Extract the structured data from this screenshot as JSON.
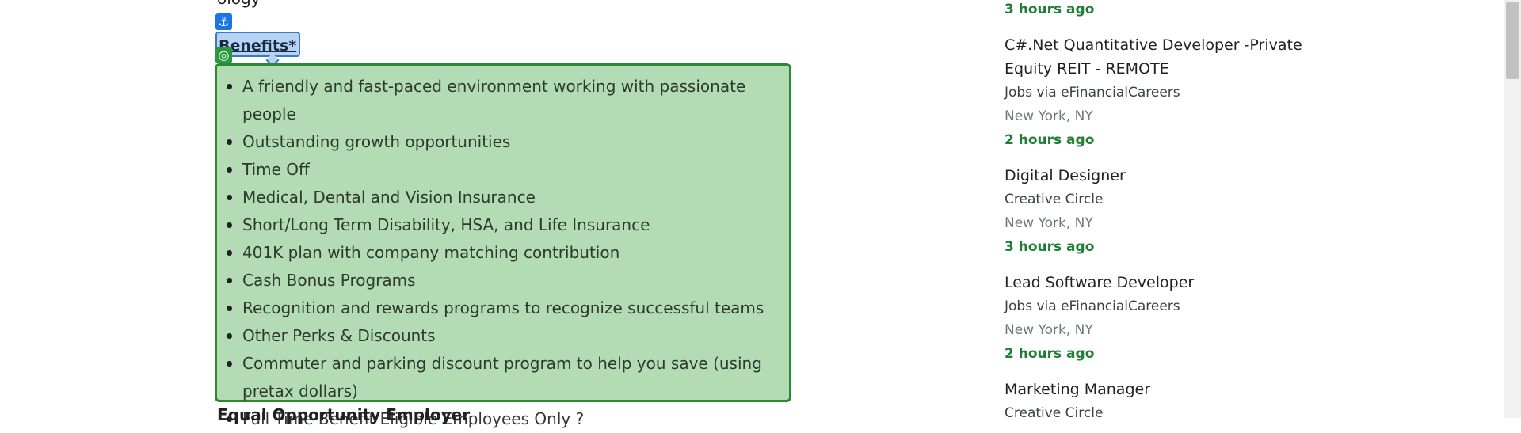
{
  "article": {
    "clipped_top_text": "ology",
    "benefits_heading": "Benefits*",
    "benefits": [
      "A friendly and fast-paced environment working with passionate people",
      "Outstanding growth opportunities",
      "Time Off",
      "Medical, Dental and Vision Insurance",
      "Short/Long Term Disability, HSA, and Life Insurance",
      "401K plan with company matching contribution",
      "Cash Bonus Programs",
      "Recognition and rewards programs to recognize successful teams",
      "Other Perks & Discounts",
      "Commuter and parking discount program to help you save (using pretax dollars)",
      "Full Time Benefit Eligible Employees Only ?"
    ],
    "next_heading": "Equal Opportunity Employer"
  },
  "badges": {
    "anchor_glyph": "⚓",
    "target_glyph": "◎"
  },
  "sidebar": {
    "top_time": "3 hours ago",
    "jobs": [
      {
        "title": "C#.Net Quantitative Developer -Private Equity REIT - REMOTE",
        "company": "Jobs via eFinancialCareers",
        "location": "New York, NY",
        "time": "2 hours ago"
      },
      {
        "title": "Digital Designer",
        "company": "Creative Circle",
        "location": "New York, NY",
        "time": "3 hours ago"
      },
      {
        "title": "Lead Software Developer",
        "company": "Jobs via eFinancialCareers",
        "location": "New York, NY",
        "time": "2 hours ago"
      },
      {
        "title": "Marketing Manager",
        "company": "Creative Circle",
        "location": "",
        "time": ""
      }
    ]
  },
  "colors": {
    "highlight_green": "#b3dcb4",
    "highlight_blue": "#b7d3f4",
    "time_green": "#1e7e34"
  }
}
